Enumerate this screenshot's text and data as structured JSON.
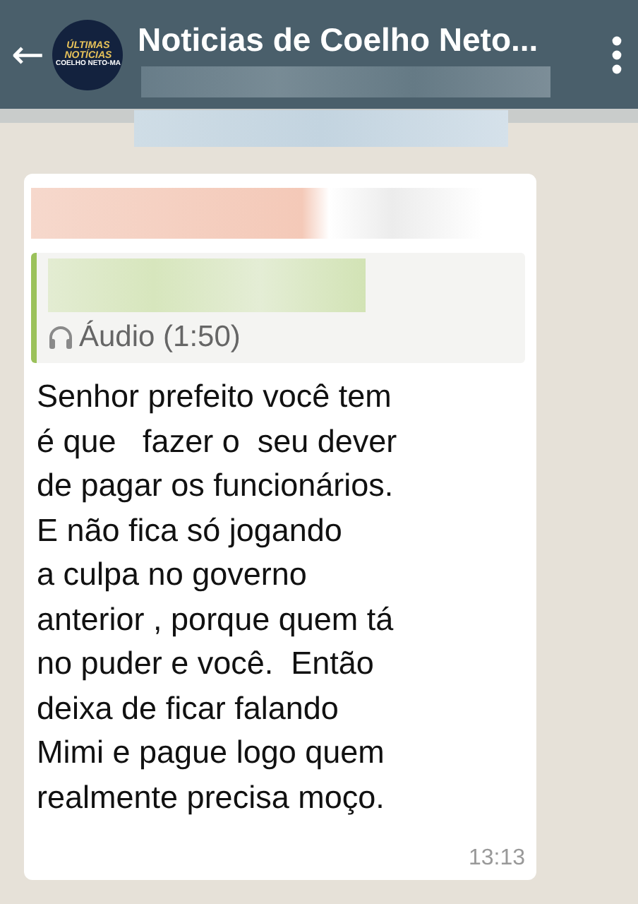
{
  "header": {
    "back_icon": "←",
    "avatar_text": [
      "ÚLTIMAS",
      "NOTÍCIAS",
      "COELHO NETO-MA"
    ],
    "title": "Noticias de Coelho Neto..."
  },
  "message": {
    "quote": {
      "text": "Áudio (1:50)"
    },
    "lines": [
      "Senhor prefeito você tem",
      "é que   fazer o  seu dever",
      "de pagar os funcionários.",
      "E não fica só jogando",
      "a culpa no governo",
      "anterior , porque quem tá",
      "no puder e você.  Então",
      "deixa de ficar falando",
      "Mimi e pague logo quem",
      "realmente precisa moço."
    ],
    "time": "13:13"
  }
}
